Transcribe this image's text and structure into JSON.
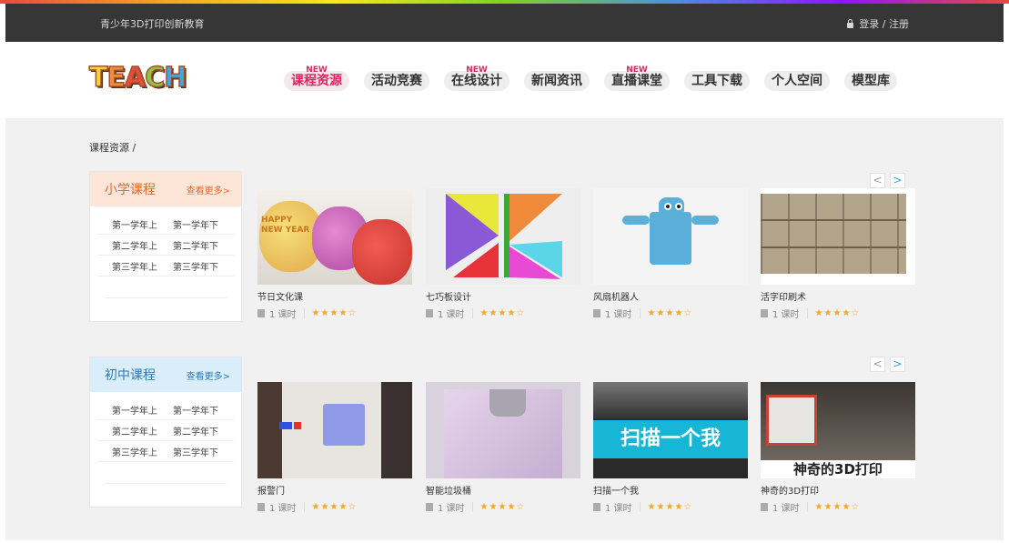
{
  "topbar": {
    "site_name": "青少年3D打印创新教育",
    "login": "登录 / 注册"
  },
  "logo": {
    "text": "TEACH"
  },
  "nav": [
    {
      "label": "课程资源",
      "badge": "NEW",
      "active": true
    },
    {
      "label": "活动竞赛",
      "badge": ""
    },
    {
      "label": "在线设计",
      "badge": "NEW"
    },
    {
      "label": "新闻资讯",
      "badge": ""
    },
    {
      "label": "直播课堂",
      "badge": "NEW"
    },
    {
      "label": "工具下载",
      "badge": ""
    },
    {
      "label": "个人空间",
      "badge": ""
    },
    {
      "label": "模型库",
      "badge": ""
    }
  ],
  "breadcrumb": "课程资源 /",
  "sections": [
    {
      "title": "小学课程",
      "more": "查看更多>",
      "grades": [
        [
          "第一学年上",
          "第一学年下"
        ],
        [
          "第二学年上",
          "第二学年下"
        ],
        [
          "第三学年上",
          "第三学年下"
        ]
      ],
      "courses": [
        {
          "title": "节日文化课",
          "lessons": "1 课时",
          "stars": "★★★★☆"
        },
        {
          "title": "七巧板设计",
          "lessons": "1 课时",
          "stars": "★★★★☆"
        },
        {
          "title": "风扇机器人",
          "lessons": "1 课时",
          "stars": "★★★★☆"
        },
        {
          "title": "活字印刷术",
          "lessons": "1 课时",
          "stars": "★★★★☆"
        }
      ]
    },
    {
      "title": "初中课程",
      "more": "查看更多>",
      "grades": [
        [
          "第一学年上",
          "第一学年下"
        ],
        [
          "第二学年上",
          "第二学年下"
        ],
        [
          "第三学年上",
          "第三学年下"
        ]
      ],
      "courses": [
        {
          "title": "报警门",
          "lessons": "1 课时",
          "stars": "★★★★☆"
        },
        {
          "title": "智能垃圾桶",
          "lessons": "1 课时",
          "stars": "★★★★☆"
        },
        {
          "title": "扫描一个我",
          "lessons": "1 课时",
          "stars": "★★★★☆"
        },
        {
          "title": "神奇的3D打印",
          "lessons": "1 课时",
          "stars": "★★★★☆"
        }
      ]
    }
  ],
  "thumb_text": {
    "lantern": "HAPPY NEW YEAR",
    "scan": "扫描一个我",
    "print": "神奇的3D打印"
  },
  "arrows": {
    "prev": "<",
    "next": ">"
  },
  "colors": {
    "accent": "#e0245e",
    "primary_section": "#e8682d",
    "middle_section": "#2c7bb8",
    "star": "#f5a623"
  }
}
